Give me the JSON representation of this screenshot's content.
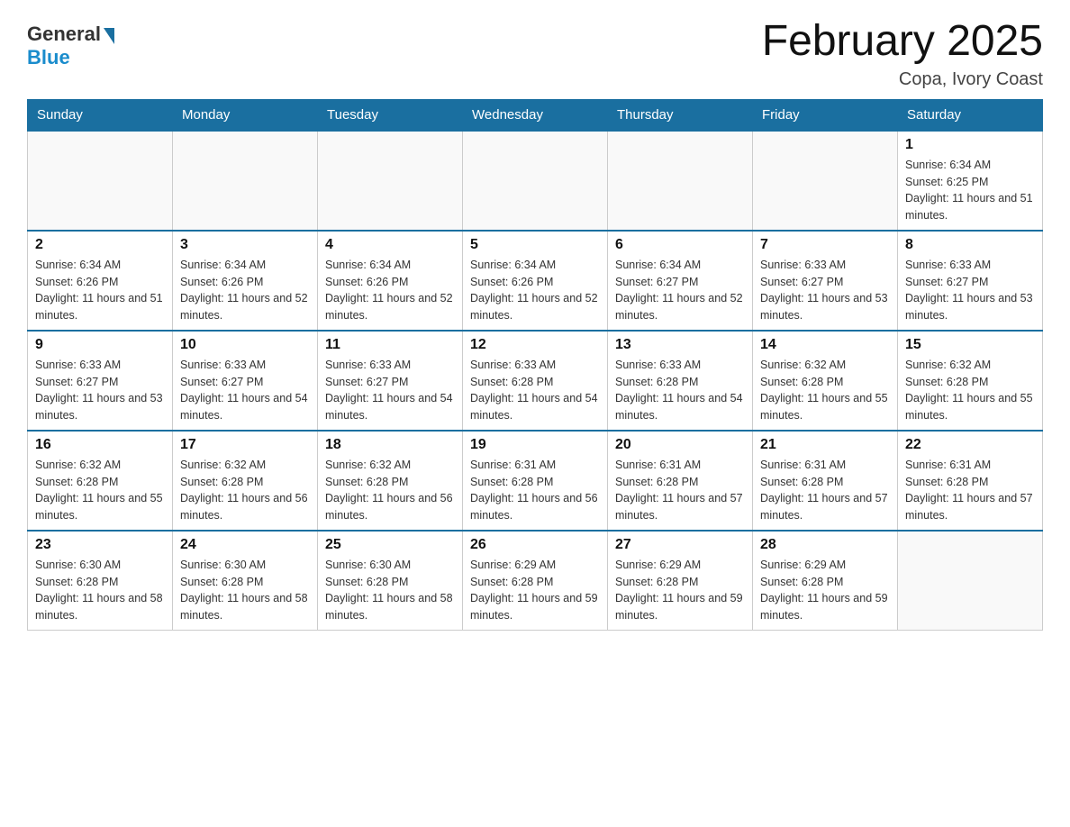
{
  "header": {
    "logo": {
      "general": "General",
      "blue": "Blue"
    },
    "title": "February 2025",
    "location": "Copa, Ivory Coast"
  },
  "weekdays": [
    "Sunday",
    "Monday",
    "Tuesday",
    "Wednesday",
    "Thursday",
    "Friday",
    "Saturday"
  ],
  "weeks": [
    [
      {
        "day": "",
        "info": ""
      },
      {
        "day": "",
        "info": ""
      },
      {
        "day": "",
        "info": ""
      },
      {
        "day": "",
        "info": ""
      },
      {
        "day": "",
        "info": ""
      },
      {
        "day": "",
        "info": ""
      },
      {
        "day": "1",
        "info": "Sunrise: 6:34 AM\nSunset: 6:25 PM\nDaylight: 11 hours and 51 minutes."
      }
    ],
    [
      {
        "day": "2",
        "info": "Sunrise: 6:34 AM\nSunset: 6:26 PM\nDaylight: 11 hours and 51 minutes."
      },
      {
        "day": "3",
        "info": "Sunrise: 6:34 AM\nSunset: 6:26 PM\nDaylight: 11 hours and 52 minutes."
      },
      {
        "day": "4",
        "info": "Sunrise: 6:34 AM\nSunset: 6:26 PM\nDaylight: 11 hours and 52 minutes."
      },
      {
        "day": "5",
        "info": "Sunrise: 6:34 AM\nSunset: 6:26 PM\nDaylight: 11 hours and 52 minutes."
      },
      {
        "day": "6",
        "info": "Sunrise: 6:34 AM\nSunset: 6:27 PM\nDaylight: 11 hours and 52 minutes."
      },
      {
        "day": "7",
        "info": "Sunrise: 6:33 AM\nSunset: 6:27 PM\nDaylight: 11 hours and 53 minutes."
      },
      {
        "day": "8",
        "info": "Sunrise: 6:33 AM\nSunset: 6:27 PM\nDaylight: 11 hours and 53 minutes."
      }
    ],
    [
      {
        "day": "9",
        "info": "Sunrise: 6:33 AM\nSunset: 6:27 PM\nDaylight: 11 hours and 53 minutes."
      },
      {
        "day": "10",
        "info": "Sunrise: 6:33 AM\nSunset: 6:27 PM\nDaylight: 11 hours and 54 minutes."
      },
      {
        "day": "11",
        "info": "Sunrise: 6:33 AM\nSunset: 6:27 PM\nDaylight: 11 hours and 54 minutes."
      },
      {
        "day": "12",
        "info": "Sunrise: 6:33 AM\nSunset: 6:28 PM\nDaylight: 11 hours and 54 minutes."
      },
      {
        "day": "13",
        "info": "Sunrise: 6:33 AM\nSunset: 6:28 PM\nDaylight: 11 hours and 54 minutes."
      },
      {
        "day": "14",
        "info": "Sunrise: 6:32 AM\nSunset: 6:28 PM\nDaylight: 11 hours and 55 minutes."
      },
      {
        "day": "15",
        "info": "Sunrise: 6:32 AM\nSunset: 6:28 PM\nDaylight: 11 hours and 55 minutes."
      }
    ],
    [
      {
        "day": "16",
        "info": "Sunrise: 6:32 AM\nSunset: 6:28 PM\nDaylight: 11 hours and 55 minutes."
      },
      {
        "day": "17",
        "info": "Sunrise: 6:32 AM\nSunset: 6:28 PM\nDaylight: 11 hours and 56 minutes."
      },
      {
        "day": "18",
        "info": "Sunrise: 6:32 AM\nSunset: 6:28 PM\nDaylight: 11 hours and 56 minutes."
      },
      {
        "day": "19",
        "info": "Sunrise: 6:31 AM\nSunset: 6:28 PM\nDaylight: 11 hours and 56 minutes."
      },
      {
        "day": "20",
        "info": "Sunrise: 6:31 AM\nSunset: 6:28 PM\nDaylight: 11 hours and 57 minutes."
      },
      {
        "day": "21",
        "info": "Sunrise: 6:31 AM\nSunset: 6:28 PM\nDaylight: 11 hours and 57 minutes."
      },
      {
        "day": "22",
        "info": "Sunrise: 6:31 AM\nSunset: 6:28 PM\nDaylight: 11 hours and 57 minutes."
      }
    ],
    [
      {
        "day": "23",
        "info": "Sunrise: 6:30 AM\nSunset: 6:28 PM\nDaylight: 11 hours and 58 minutes."
      },
      {
        "day": "24",
        "info": "Sunrise: 6:30 AM\nSunset: 6:28 PM\nDaylight: 11 hours and 58 minutes."
      },
      {
        "day": "25",
        "info": "Sunrise: 6:30 AM\nSunset: 6:28 PM\nDaylight: 11 hours and 58 minutes."
      },
      {
        "day": "26",
        "info": "Sunrise: 6:29 AM\nSunset: 6:28 PM\nDaylight: 11 hours and 59 minutes."
      },
      {
        "day": "27",
        "info": "Sunrise: 6:29 AM\nSunset: 6:28 PM\nDaylight: 11 hours and 59 minutes."
      },
      {
        "day": "28",
        "info": "Sunrise: 6:29 AM\nSunset: 6:28 PM\nDaylight: 11 hours and 59 minutes."
      },
      {
        "day": "",
        "info": ""
      }
    ]
  ]
}
